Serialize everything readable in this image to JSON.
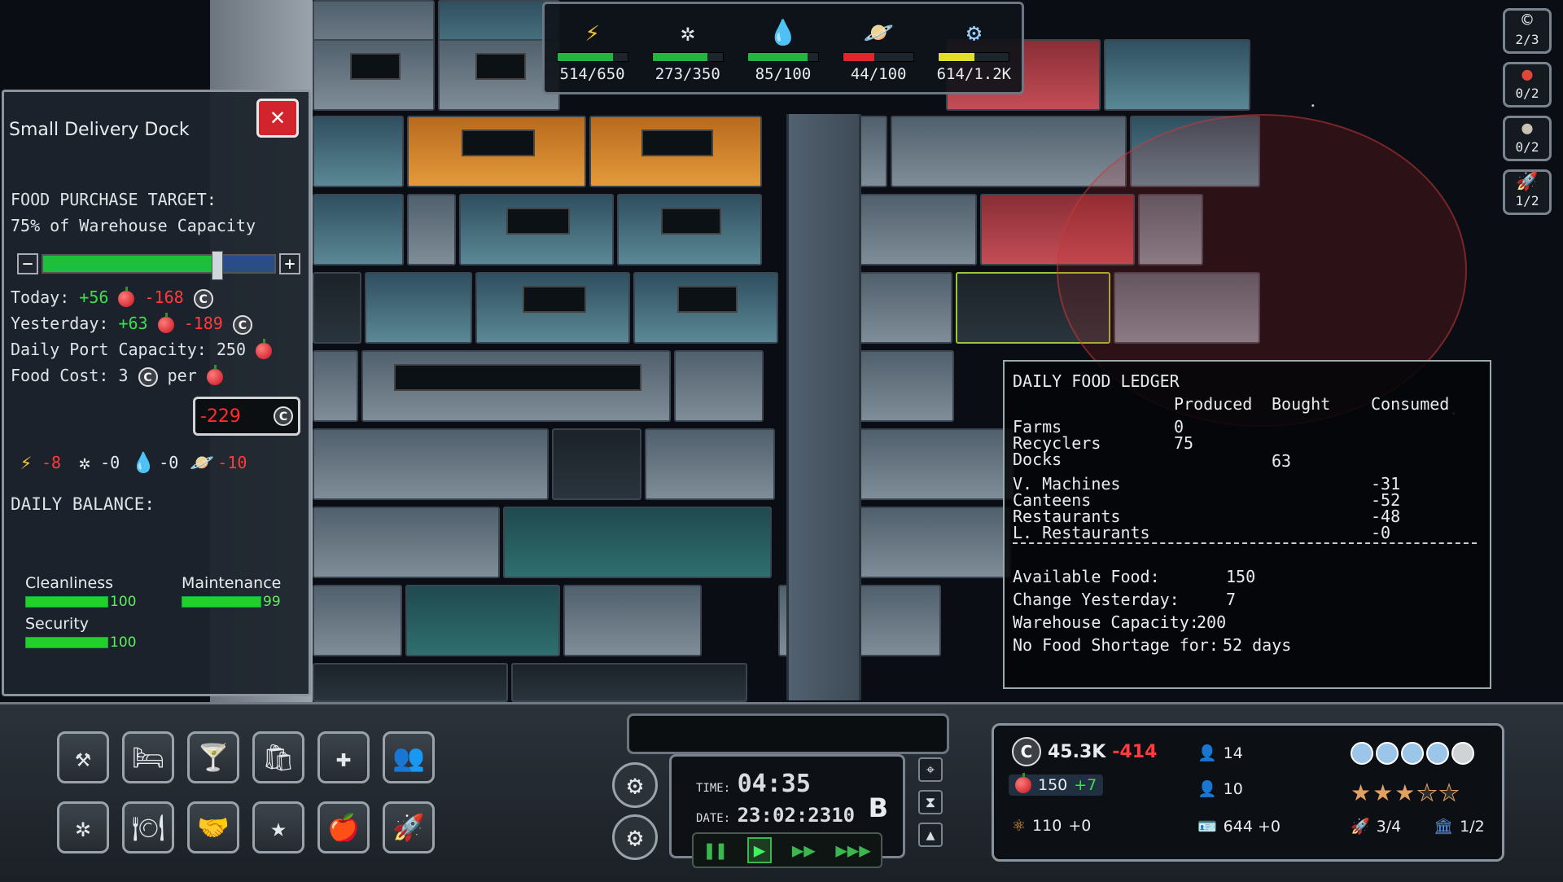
{
  "resources": [
    {
      "name": "power-icon",
      "glyph": "⚡",
      "value": "514/650",
      "fill": 0.79,
      "color": "#21b641"
    },
    {
      "name": "air-icon",
      "glyph": "✲",
      "value": "273/350",
      "fill": 0.78,
      "color": "#21b641"
    },
    {
      "name": "water-icon",
      "glyph": "💧",
      "value": "85/100",
      "fill": 0.85,
      "color": "#21b641"
    },
    {
      "name": "planet-icon",
      "glyph": "🪐",
      "value": "44/100",
      "fill": 0.44,
      "color": "#e0262d"
    },
    {
      "name": "gear-tech-icon",
      "glyph": "⚙",
      "value": "614/1.2K",
      "fill": 0.51,
      "color": "#e2dc2a"
    }
  ],
  "panel": {
    "title": "Small Delivery Dock",
    "close_label": "✕",
    "target_label": "FOOD PURCHASE TARGET:",
    "target_value": "75% of Warehouse Capacity",
    "slider_minus": "−",
    "slider_plus": "+",
    "slider_fill": 0.75,
    "today_label": "Today:",
    "today_plus": "+56",
    "today_minus": "-168",
    "yesterday_label": "Yesterday:",
    "yesterday_plus": "+63",
    "yesterday_minus": "-189",
    "capacity_label": "Daily Port Capacity:",
    "capacity_value": "250",
    "cost_label": "Food Cost:",
    "cost_value": "3",
    "cost_per": "per",
    "balance_label": "DAILY BALANCE:",
    "balance_value": "-229",
    "deltas": [
      {
        "name": "power-delta",
        "glyph": "⚡",
        "value": "-8",
        "color": "#ff3b3b"
      },
      {
        "name": "air-delta",
        "glyph": "✲",
        "value": "-0",
        "color": "#e8ecef"
      },
      {
        "name": "water-delta",
        "glyph": "💧",
        "value": "-0",
        "color": "#e8ecef"
      },
      {
        "name": "planet-delta",
        "glyph": "🪐",
        "value": "-10",
        "color": "#ff3b3b"
      }
    ],
    "cleanliness_label": "Cleanliness",
    "cleanliness_value": "100",
    "maintenance_label": "Maintenance",
    "maintenance_value": "99",
    "security_label": "Security",
    "security_value": "100"
  },
  "ledger": {
    "title": "DAILY FOOD LEDGER",
    "col_produced": "Produced",
    "col_bought": "Bought",
    "col_consumed": "Consumed",
    "farms": "Farms",
    "farms_produced": "0",
    "recyclers": "Recyclers",
    "recyclers_produced": "75",
    "docks": "Docks",
    "docks_bought": "63",
    "vmachines": "V. Machines",
    "vmachines_consumed": "-31",
    "canteens": "Canteens",
    "canteens_consumed": "-52",
    "restaurants": "Restaurants",
    "restaurants_consumed": "-48",
    "lrestaurants": "L. Restaurants",
    "lrestaurants_consumed": "-0",
    "available_label": "Available Food:",
    "available_value": "150",
    "change_label": "Change Yesterday:",
    "change_value": "7",
    "warehouse_label": "Warehouse Capacity:",
    "warehouse_value": "200",
    "shortage_label": "No Food Shortage for:",
    "shortage_value": "52 days"
  },
  "toolbar": [
    {
      "name": "build-tools-button",
      "glyph": "⚒"
    },
    {
      "name": "beds-button",
      "glyph": "🛏"
    },
    {
      "name": "bar-button",
      "glyph": "🍸"
    },
    {
      "name": "shop-button",
      "glyph": "🛍"
    },
    {
      "name": "medical-button",
      "glyph": "✚"
    },
    {
      "name": "crew-button",
      "glyph": "👥"
    },
    {
      "name": "vent-button",
      "glyph": "✲"
    },
    {
      "name": "dining-button",
      "glyph": "🍽"
    },
    {
      "name": "deals-button",
      "glyph": "🤝"
    },
    {
      "name": "star-button",
      "glyph": "★"
    },
    {
      "name": "food-button",
      "glyph": "🍎"
    },
    {
      "name": "rocket-button",
      "glyph": "🚀"
    }
  ],
  "clock": {
    "time_label": "TIME:",
    "time_value": "04:35",
    "date_label": "DATE:",
    "date_value": "23:02:2310",
    "mode": "B"
  },
  "speed": {
    "pause": "❚❚",
    "play": "▶",
    "fast": "▶▶",
    "faster": "▶▶▶"
  },
  "summary": {
    "credits": "45.3K",
    "credits_delta": "-414",
    "food": "150",
    "food_delta": "+7",
    "research": "110",
    "research_delta": "+0",
    "crew_a": "14",
    "crew_b": "10",
    "visitors": "644 +0",
    "ships": "3/4",
    "docks": "1/2",
    "rating_on": 3,
    "rating_total": 5,
    "thumbs_on": 4,
    "thumbs_total": 5
  },
  "right_buttons": [
    {
      "name": "credits-goal-button",
      "glyph": "©",
      "value": "2/3"
    },
    {
      "name": "planet-red-button",
      "glyph": "●",
      "value": "0/2"
    },
    {
      "name": "planet-moon-button",
      "glyph": "●",
      "value": "0/2"
    },
    {
      "name": "ship-goal-button",
      "glyph": "🚀",
      "value": "1/2"
    }
  ],
  "colors": {
    "accent_red": "#ff3b3b",
    "accent_green": "#3fdc52"
  }
}
